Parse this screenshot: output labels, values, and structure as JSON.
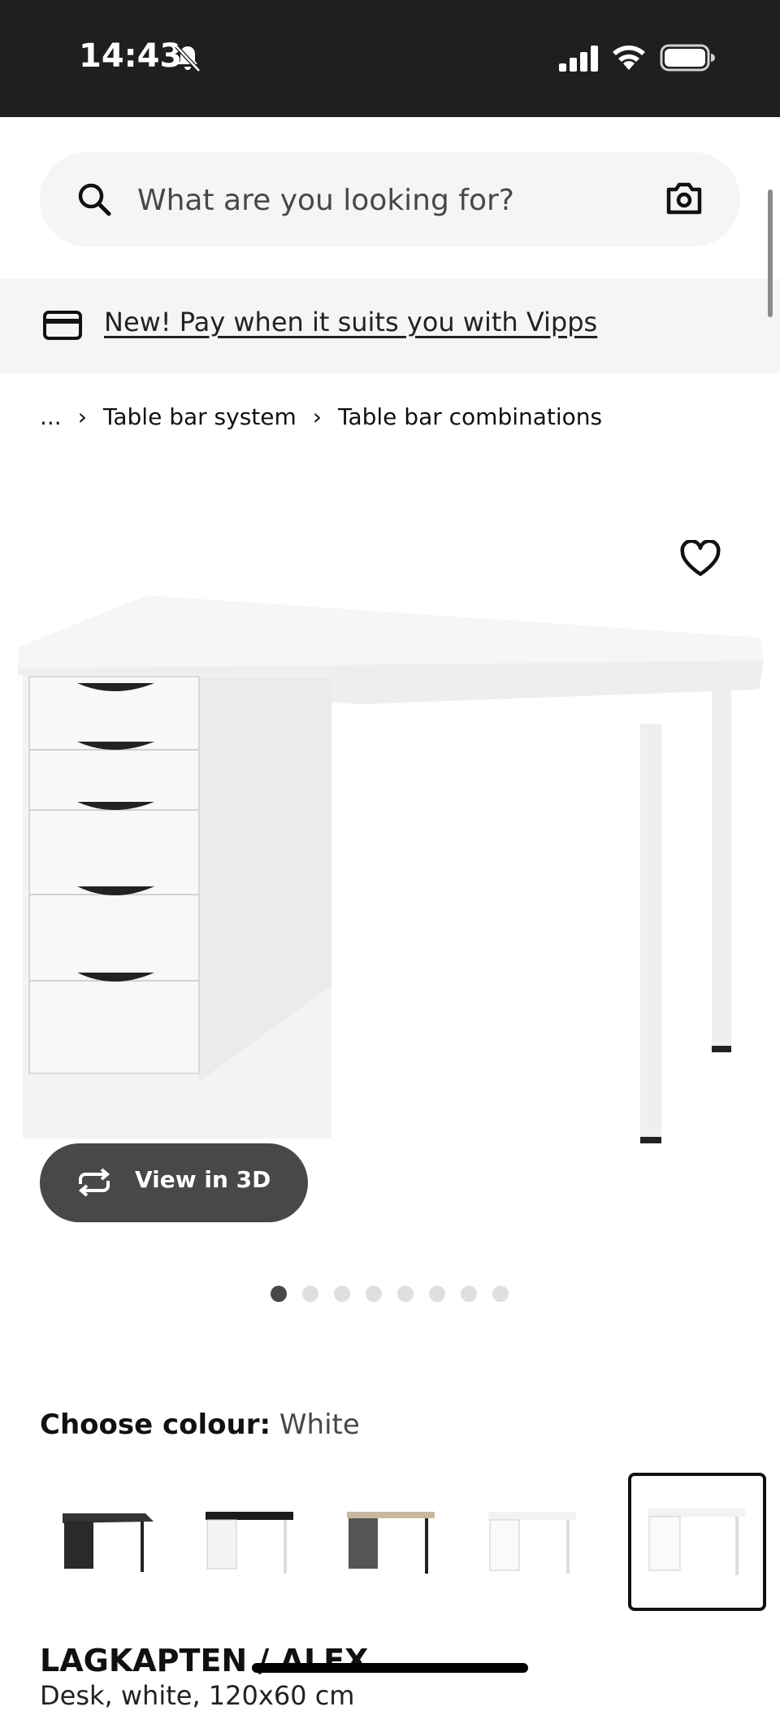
{
  "status_bar": {
    "time": "14:43",
    "icons": [
      "bell-slash-icon",
      "cellular-signal-icon",
      "wifi-icon",
      "battery-icon"
    ]
  },
  "search": {
    "placeholder": "What are you looking for?",
    "icons": [
      "search-icon",
      "camera-icon"
    ]
  },
  "promo": {
    "text": "New! Pay when it suits you with Vipps",
    "icon": "credit-card-icon"
  },
  "breadcrumb": {
    "items": [
      "...",
      "Table bar system",
      "Table bar combinations"
    ]
  },
  "product_media": {
    "view_3d_label": "View in 3D",
    "image_count": 8,
    "active_image_index": 0
  },
  "colour": {
    "label": "Choose colour:",
    "selected": "White",
    "swatch_count": 5,
    "selected_index": 4
  },
  "product": {
    "name": "LAGKAPTEN / ALEX",
    "description": "Desk, white, 120x60 cm"
  },
  "colors": {
    "status_bar_bg": "#1f1f1f",
    "search_bg": "#f5f5f5",
    "button_dark": "#484848",
    "dot_inactive": "#dfdfdf"
  }
}
